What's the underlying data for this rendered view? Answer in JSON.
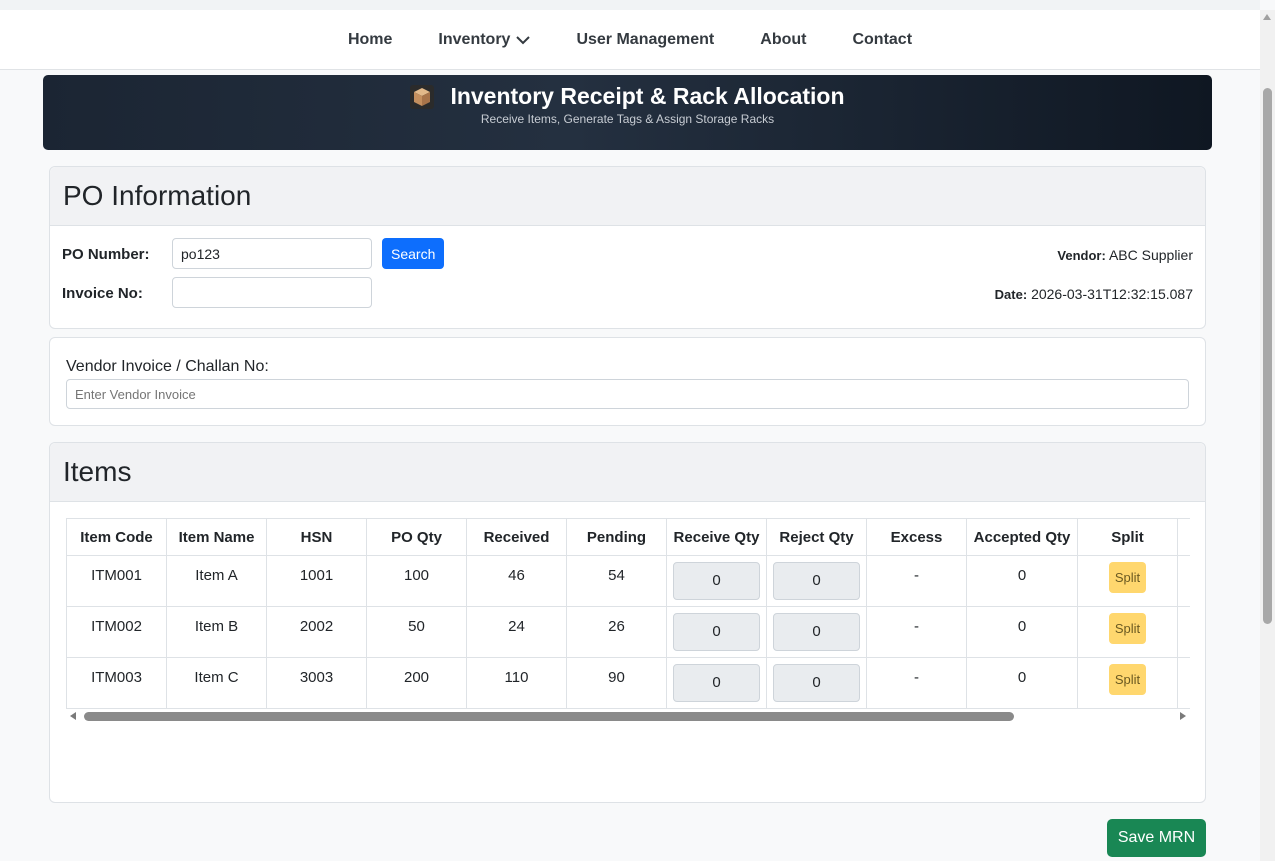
{
  "nav": {
    "items": [
      {
        "label": "Home"
      },
      {
        "label": "Inventory",
        "has_dropdown": true
      },
      {
        "label": "User Management"
      },
      {
        "label": "About"
      },
      {
        "label": "Contact"
      }
    ]
  },
  "banner": {
    "icon": "package-icon",
    "title": "Inventory Receipt & Rack Allocation",
    "subtitle": "Receive Items, Generate Tags & Assign Storage Racks"
  },
  "po_info": {
    "header": "PO Information",
    "po_number_label": "PO Number:",
    "po_number_value": "po123",
    "search_label": "Search",
    "invoice_label": "Invoice No:",
    "invoice_value": "",
    "vendor_label": "Vendor:",
    "vendor_value": "ABC Supplier",
    "date_label": "Date:",
    "date_value": "2026-03-31T12:32:15.087"
  },
  "vendor_invoice": {
    "label": "Vendor Invoice / Challan No:",
    "placeholder": "Enter Vendor Invoice"
  },
  "items": {
    "header": "Items",
    "columns": [
      "Item Code",
      "Item Name",
      "HSN",
      "PO Qty",
      "Received",
      "Pending",
      "Receive Qty",
      "Reject Qty",
      "Excess",
      "Accepted Qty",
      "Split"
    ],
    "split_label": "Split",
    "rows": [
      {
        "code": "ITM001",
        "name": "Item A",
        "hsn": "1001",
        "po_qty": "100",
        "received": "46",
        "pending": "54",
        "receive_qty": "0",
        "reject_qty": "0",
        "excess": "-",
        "accepted": "0"
      },
      {
        "code": "ITM002",
        "name": "Item B",
        "hsn": "2002",
        "po_qty": "50",
        "received": "24",
        "pending": "26",
        "receive_qty": "0",
        "reject_qty": "0",
        "excess": "-",
        "accepted": "0"
      },
      {
        "code": "ITM003",
        "name": "Item C",
        "hsn": "3003",
        "po_qty": "200",
        "received": "110",
        "pending": "90",
        "receive_qty": "0",
        "reject_qty": "0",
        "excess": "-",
        "accepted": "0"
      }
    ]
  },
  "actions": {
    "save_label": "Save MRN"
  },
  "colors": {
    "primary": "#0d6efd",
    "success": "#198754",
    "warning": "#ffd76e",
    "banner_dark": "#1b2533"
  }
}
